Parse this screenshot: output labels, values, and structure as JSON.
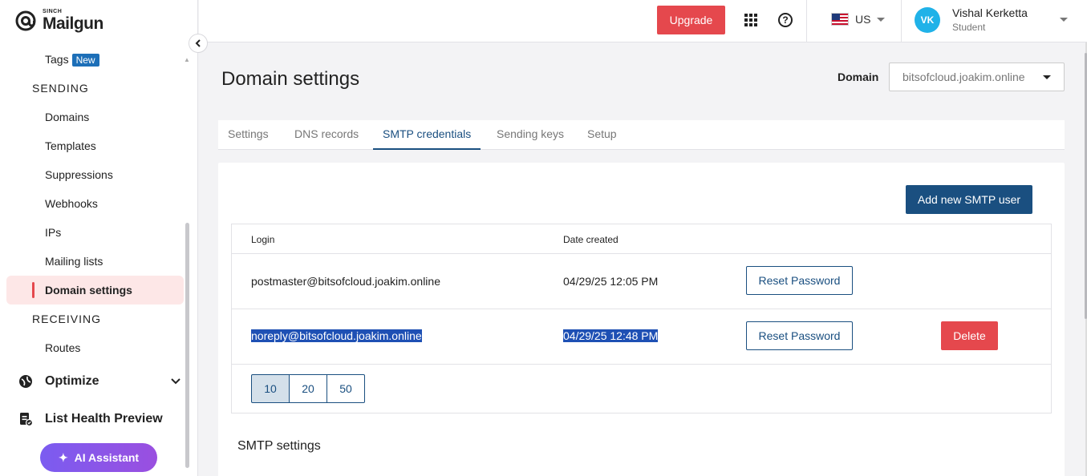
{
  "brand": {
    "sinch": "SINCH",
    "name": "Mailgun"
  },
  "sidebar": {
    "tags": {
      "label": "Tags",
      "badge": "New"
    },
    "sending_header": "SENDING",
    "sending_items": [
      {
        "label": "Domains"
      },
      {
        "label": "Templates"
      },
      {
        "label": "Suppressions"
      },
      {
        "label": "Webhooks"
      },
      {
        "label": "IPs"
      },
      {
        "label": "Mailing lists"
      },
      {
        "label": "Domain settings",
        "active": true
      }
    ],
    "receiving_header": "RECEIVING",
    "receiving_items": [
      {
        "label": "Routes"
      }
    ],
    "optimize": "Optimize",
    "list_health": "List Health Preview",
    "ai_assistant": "AI Assistant"
  },
  "topbar": {
    "upgrade": "Upgrade",
    "region": "US",
    "user": {
      "initials": "VK",
      "name": "Vishal Kerketta",
      "role": "Student"
    }
  },
  "page": {
    "title": "Domain settings",
    "domain_label": "Domain",
    "domain_value": "bitsofcloud.joakim.online",
    "tabs": [
      "Settings",
      "DNS records",
      "SMTP credentials",
      "Sending keys",
      "Setup"
    ],
    "active_tab": "SMTP credentials"
  },
  "smtp": {
    "add_button": "Add new SMTP user",
    "columns": {
      "login": "Login",
      "date_created": "Date created"
    },
    "rows": [
      {
        "login": "postmaster@bitsofcloud.joakim.online",
        "date": "04/29/25 12:05 PM",
        "reset": "Reset Password"
      },
      {
        "login": "noreply@bitsofcloud.joakim.online",
        "date": "04/29/25 12:48 PM",
        "reset": "Reset Password",
        "delete": "Delete"
      }
    ],
    "page_sizes": [
      "10",
      "20",
      "50"
    ],
    "settings_heading": "SMTP settings"
  },
  "colors": {
    "accent": "#1a4f80",
    "danger": "#e5484d",
    "avatar": "#20b2e8",
    "ai_gradient": "#7b5cf0"
  }
}
